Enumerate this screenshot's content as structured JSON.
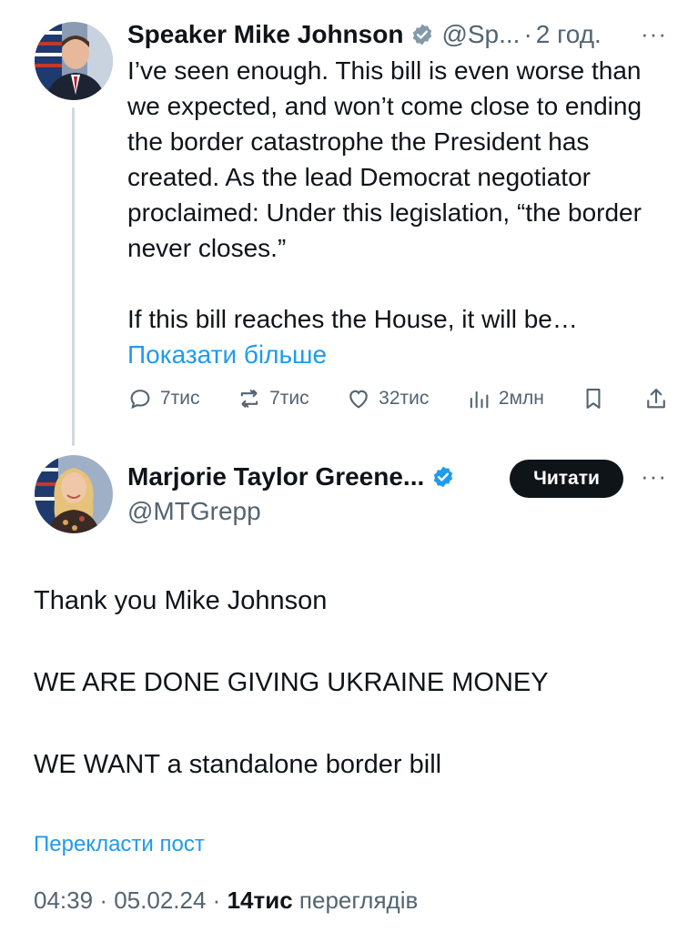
{
  "tweet1": {
    "author_name": "Speaker Mike Johnson",
    "handle": "@Sp...",
    "separator": "·",
    "time": "2 год.",
    "paragraphs": [
      "I’ve seen enough. This bill is even worse than we expected, and won’t come close to ending the border catastrophe the President has created. As the lead Democrat negotiator proclaimed: Under this legislation, “the border never closes.”",
      "If this bill reaches the House, it will be…"
    ],
    "show_more": "Показати більше",
    "more_icon": "···",
    "actions": {
      "replies": "7тис",
      "reposts": "7тис",
      "likes": "32тис",
      "views": "2млн"
    }
  },
  "tweet2": {
    "author_name": "Marjorie Taylor Greene...",
    "handle": "@MTGrepp",
    "follow_label": "Читати",
    "more_icon": "···",
    "paragraphs": [
      "Thank you Mike Johnson",
      "WE ARE DONE GIVING UKRAINE MONEY",
      "WE WANT a standalone border bill"
    ],
    "translate_label": "Перекласти пост",
    "meta": {
      "time": "04:39",
      "separator": "·",
      "date": "05.02.24",
      "views_count": "14тис",
      "views_label": "переглядів"
    }
  },
  "colors": {
    "accent": "#1d9bf0",
    "text": "#0f1419",
    "secondary": "#536471",
    "follow_button": "#0f1419"
  },
  "icons": [
    "verified-badge-icon",
    "more-icon",
    "reply-icon",
    "repost-icon",
    "like-icon",
    "views-icon",
    "bookmark-icon",
    "share-icon"
  ]
}
